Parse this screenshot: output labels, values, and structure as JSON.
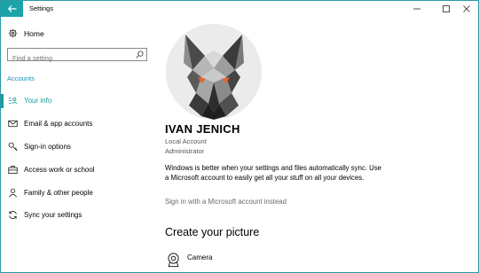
{
  "window": {
    "title": "Settings"
  },
  "sidebar": {
    "home_label": "Home",
    "search_placeholder": "Find a setting",
    "section_label": "Accounts",
    "items": [
      {
        "label": "Your info",
        "icon": "person-card-icon",
        "active": true
      },
      {
        "label": "Email & app accounts",
        "icon": "mail-icon",
        "active": false
      },
      {
        "label": "Sign-in options",
        "icon": "key-icon",
        "active": false
      },
      {
        "label": "Access work or school",
        "icon": "briefcase-icon",
        "active": false
      },
      {
        "label": "Family & other people",
        "icon": "person-icon",
        "active": false
      },
      {
        "label": "Sync your settings",
        "icon": "sync-icon",
        "active": false
      }
    ]
  },
  "main": {
    "user_name": "IVAN JENICH",
    "account_type": "Local Account",
    "account_role": "Administrator",
    "sync_message": "Windows is better when your settings and files automatically sync. Use a Microsoft account to easily get all your stuff on all your devices.",
    "ms_account_link": "Sign in with a Microsoft account instead",
    "create_heading": "Create your picture",
    "camera_label": "Camera"
  },
  "colors": {
    "accent": "#1a9aa0",
    "window_border": "#2b9aa4"
  }
}
